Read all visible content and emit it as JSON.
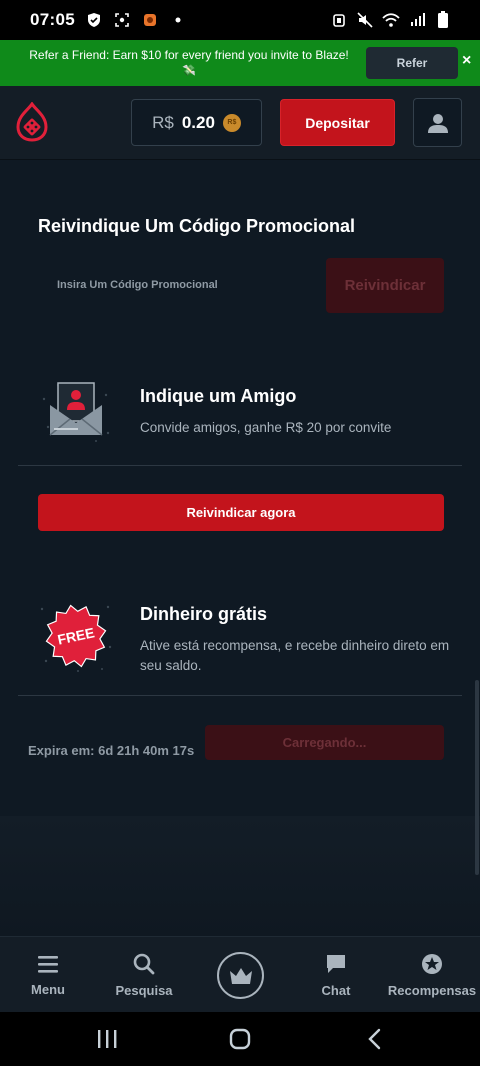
{
  "status_bar": {
    "time": "07:05"
  },
  "banner": {
    "text": "Refer a Friend: Earn $10 for every friend you invite to Blaze!",
    "emoji": "💸",
    "button_label": "Refer",
    "close_glyph": "×",
    "color": "#0f8a1a"
  },
  "header": {
    "balance_currency": "R$",
    "balance_amount": "0.20",
    "coin_label": "R$",
    "deposit_label": "Depositar",
    "brand_color": "#c3141c"
  },
  "promo": {
    "title": "Reivindique Um Código Promocional",
    "placeholder": "Insira Um Código Promocional",
    "button_label": "Reivindicar"
  },
  "refer_card": {
    "title": "Indique um Amigo",
    "subtitle": "Convide amigos, ganhe R$ 20 por convite",
    "button_label": "Reivindicar agora",
    "icon": "envelope-user-icon"
  },
  "free_card": {
    "title": "Dinheiro grátis",
    "subtitle": "Ative está recompensa, e recebe dinheiro direto em seu saldo.",
    "badge_text": "FREE",
    "expires": "Expira em: 6d 21h 40m 17s",
    "button_label": "Carregando..."
  },
  "bottom_nav": {
    "items": [
      {
        "label": "Menu",
        "icon": "menu-icon"
      },
      {
        "label": "Pesquisa",
        "icon": "search-icon"
      },
      {
        "label": "",
        "icon": "crown-icon"
      },
      {
        "label": "Chat",
        "icon": "chat-icon"
      },
      {
        "label": "Recompensas",
        "icon": "star-badge-icon"
      }
    ]
  }
}
